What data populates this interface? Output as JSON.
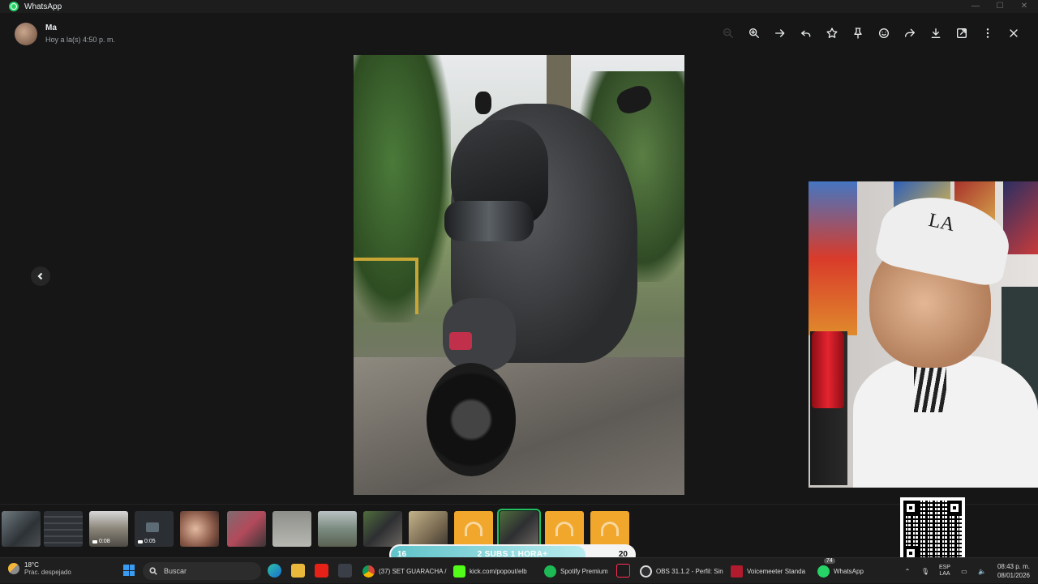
{
  "window": {
    "title": "WhatsApp"
  },
  "header": {
    "sender": "Ma",
    "subtitle": "Hoy a la(s) 4:50 p. m."
  },
  "toolbar": {
    "items": [
      "zoom-out-icon",
      "zoom-in-icon",
      "forward-icon",
      "reply-icon",
      "star-icon",
      "pin-icon",
      "react-icon",
      "share-icon",
      "download-icon",
      "open-external-icon",
      "more-icon",
      "close-icon"
    ]
  },
  "strip": {
    "durations": [
      "0:08",
      "0:05"
    ]
  },
  "goal": {
    "current": "16",
    "label": "2 SUBS 1 HORA+",
    "target": "20",
    "progress": 0.8
  },
  "taskbar": {
    "weather_temp": "18°C",
    "weather_desc": "Prac. despejado",
    "search_placeholder": "Buscar",
    "apps": [
      {
        "label": "(37) SET GUARACHA /"
      },
      {
        "label": "kick.com/popout/elb"
      },
      {
        "label": "Spotify Premium"
      },
      {
        "label": "OBS 31.1.2 - Perfil: Sin"
      },
      {
        "label": "Voicemeeter Standa"
      },
      {
        "label": "WhatsApp"
      }
    ],
    "whatsapp_badge": "74",
    "lang": "ESP LAA",
    "time": "08:43 p. m.",
    "date": "08/01/2026"
  },
  "colors": {
    "accent": "#21c063",
    "audio_thumb": "#f0a72b",
    "background": "#161616"
  }
}
